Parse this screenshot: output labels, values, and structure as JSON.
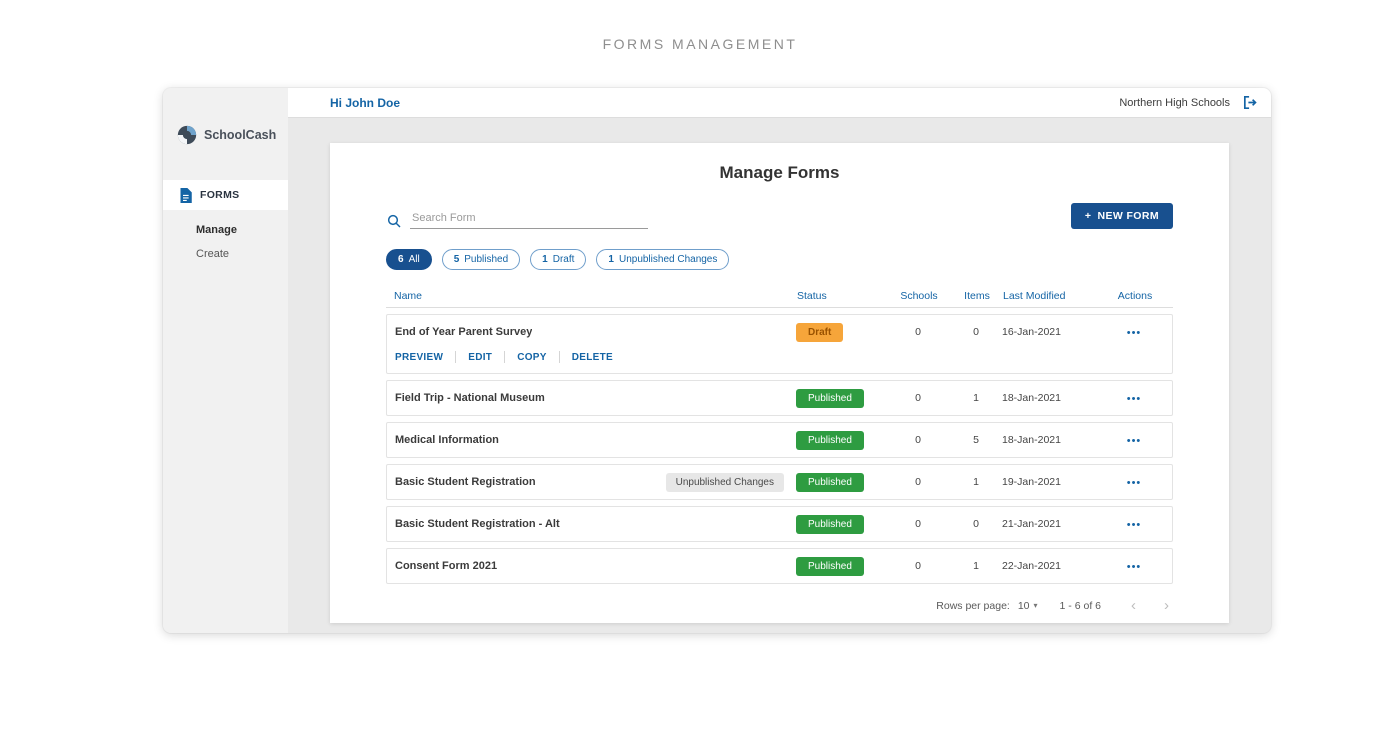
{
  "page_title": "FORMS MANAGEMENT",
  "topbar": {
    "greeting": "Hi John Doe",
    "school": "Northern High Schools"
  },
  "sidebar": {
    "brand": "SchoolCash",
    "section": "FORMS",
    "items": [
      {
        "label": "Manage",
        "active": true
      },
      {
        "label": "Create",
        "active": false
      }
    ]
  },
  "main": {
    "heading": "Manage Forms",
    "search": {
      "placeholder": "Search Form",
      "value": ""
    },
    "new_form_button": {
      "plus": "+",
      "label": "NEW FORM"
    },
    "filters": [
      {
        "count": "6",
        "label": "All",
        "active": true
      },
      {
        "count": "5",
        "label": "Published",
        "active": false
      },
      {
        "count": "1",
        "label": "Draft",
        "active": false
      },
      {
        "count": "1",
        "label": "Unpublished Changes",
        "active": false
      }
    ],
    "table": {
      "headers": [
        "Name",
        "Status",
        "Schools",
        "Items",
        "Last Modified",
        "Actions"
      ],
      "menu_glyph": "•••",
      "rows": [
        {
          "name": "End of Year Parent Survey",
          "badge": "",
          "status": "Draft",
          "schools": "0",
          "items": "0",
          "modified": "16-Jan-2021",
          "expanded": true,
          "actions": [
            "PREVIEW",
            "EDIT",
            "COPY",
            "DELETE"
          ]
        },
        {
          "name": "Field Trip - National Museum",
          "badge": "",
          "status": "Published",
          "schools": "0",
          "items": "1",
          "modified": "18-Jan-2021",
          "expanded": false
        },
        {
          "name": "Medical Information",
          "badge": "",
          "status": "Published",
          "schools": "0",
          "items": "5",
          "modified": "18-Jan-2021",
          "expanded": false
        },
        {
          "name": "Basic Student Registration",
          "badge": "Unpublished Changes",
          "status": "Published",
          "schools": "0",
          "items": "1",
          "modified": "19-Jan-2021",
          "expanded": false
        },
        {
          "name": "Basic Student Registration - Alt",
          "badge": "",
          "status": "Published",
          "schools": "0",
          "items": "0",
          "modified": "21-Jan-2021",
          "expanded": false
        },
        {
          "name": "Consent Form 2021",
          "badge": "",
          "status": "Published",
          "schools": "0",
          "items": "1",
          "modified": "22-Jan-2021",
          "expanded": false
        }
      ]
    },
    "pagination": {
      "label": "Rows per page:",
      "per_page": "10",
      "caret": "▾",
      "range": "1 - 6 of 6",
      "prev": "‹",
      "next": "›"
    }
  },
  "colors": {
    "accent_blue": "#1464A5",
    "dark_blue": "#18508F",
    "published_green": "#2E9C41",
    "draft_orange": "#F6A53A",
    "draft_text": "#9A5200"
  }
}
